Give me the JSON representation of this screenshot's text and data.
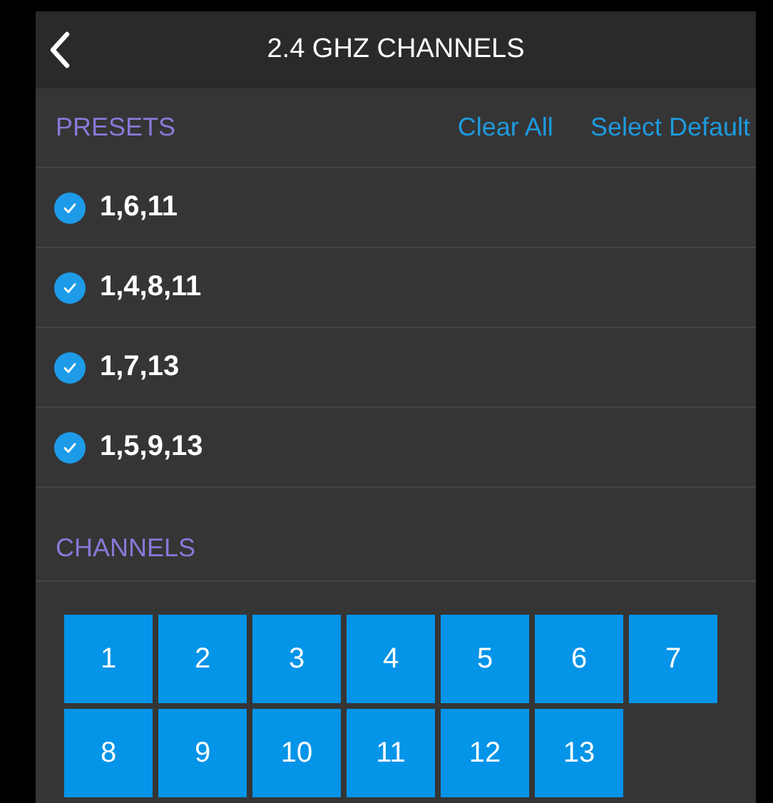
{
  "header": {
    "title": "2.4 GHZ CHANNELS"
  },
  "presets": {
    "title": "PRESETS",
    "actions": [
      "Clear All",
      "Select Default"
    ],
    "items": [
      {
        "label": "1,6,11",
        "checked": true
      },
      {
        "label": "1,4,8,11",
        "checked": true
      },
      {
        "label": "1,7,13",
        "checked": true
      },
      {
        "label": "1,5,9,13",
        "checked": true
      }
    ]
  },
  "channels": {
    "title": "CHANNELS",
    "items": [
      {
        "label": "1",
        "selected": true
      },
      {
        "label": "2",
        "selected": true
      },
      {
        "label": "3",
        "selected": true
      },
      {
        "label": "4",
        "selected": true
      },
      {
        "label": "5",
        "selected": true
      },
      {
        "label": "6",
        "selected": true
      },
      {
        "label": "7",
        "selected": true
      },
      {
        "label": "8",
        "selected": true
      },
      {
        "label": "9",
        "selected": true
      },
      {
        "label": "10",
        "selected": true
      },
      {
        "label": "11",
        "selected": true
      },
      {
        "label": "12",
        "selected": true
      },
      {
        "label": "13",
        "selected": true
      }
    ]
  }
}
